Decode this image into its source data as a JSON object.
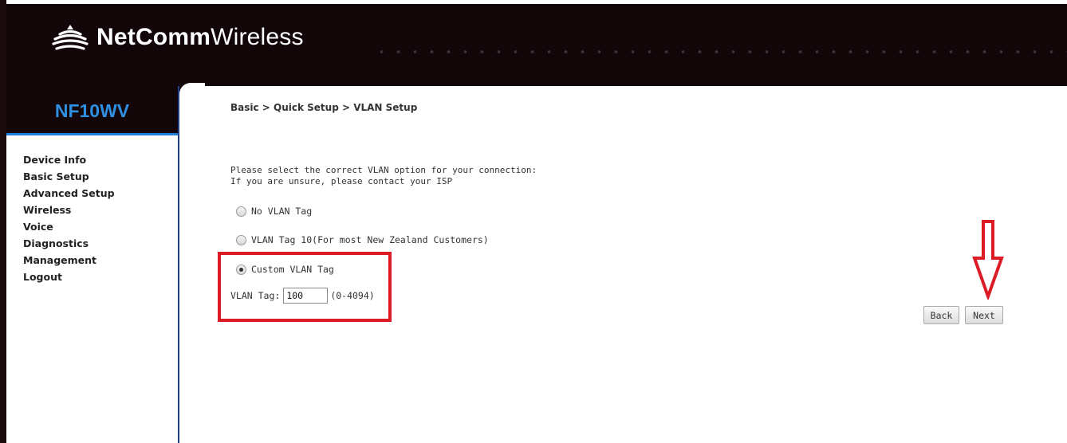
{
  "brand": {
    "name_bold": "NetComm",
    "name_light": "Wireless"
  },
  "sidebar": {
    "model": "NF10WV",
    "items": [
      {
        "label": "Device Info"
      },
      {
        "label": "Basic Setup"
      },
      {
        "label": "Advanced Setup"
      },
      {
        "label": "Wireless"
      },
      {
        "label": "Voice"
      },
      {
        "label": "Diagnostics"
      },
      {
        "label": "Management"
      },
      {
        "label": "Logout"
      }
    ]
  },
  "main": {
    "breadcrumb": "Basic > Quick Setup > VLAN Setup",
    "intro_line1": "Please select the correct VLAN option for your connection:",
    "intro_line2": "If you are unsure, please contact your ISP",
    "options": [
      {
        "label": "No VLAN Tag",
        "checked": false
      },
      {
        "label": "VLAN Tag 10(For most New Zealand Customers)",
        "checked": false
      },
      {
        "label": "Custom VLAN Tag",
        "checked": true
      }
    ],
    "vlan_tag": {
      "label": "VLAN Tag:",
      "value": "100",
      "range": "(0-4094)"
    },
    "buttons": {
      "back": "Back",
      "next": "Next"
    }
  },
  "colors": {
    "highlight": "#dd1b24",
    "model_text": "#2f8fe0",
    "header_bg": "#120609"
  },
  "icons": {
    "logo": "wifi-logo-icon",
    "annotation": "down-arrow-icon"
  }
}
